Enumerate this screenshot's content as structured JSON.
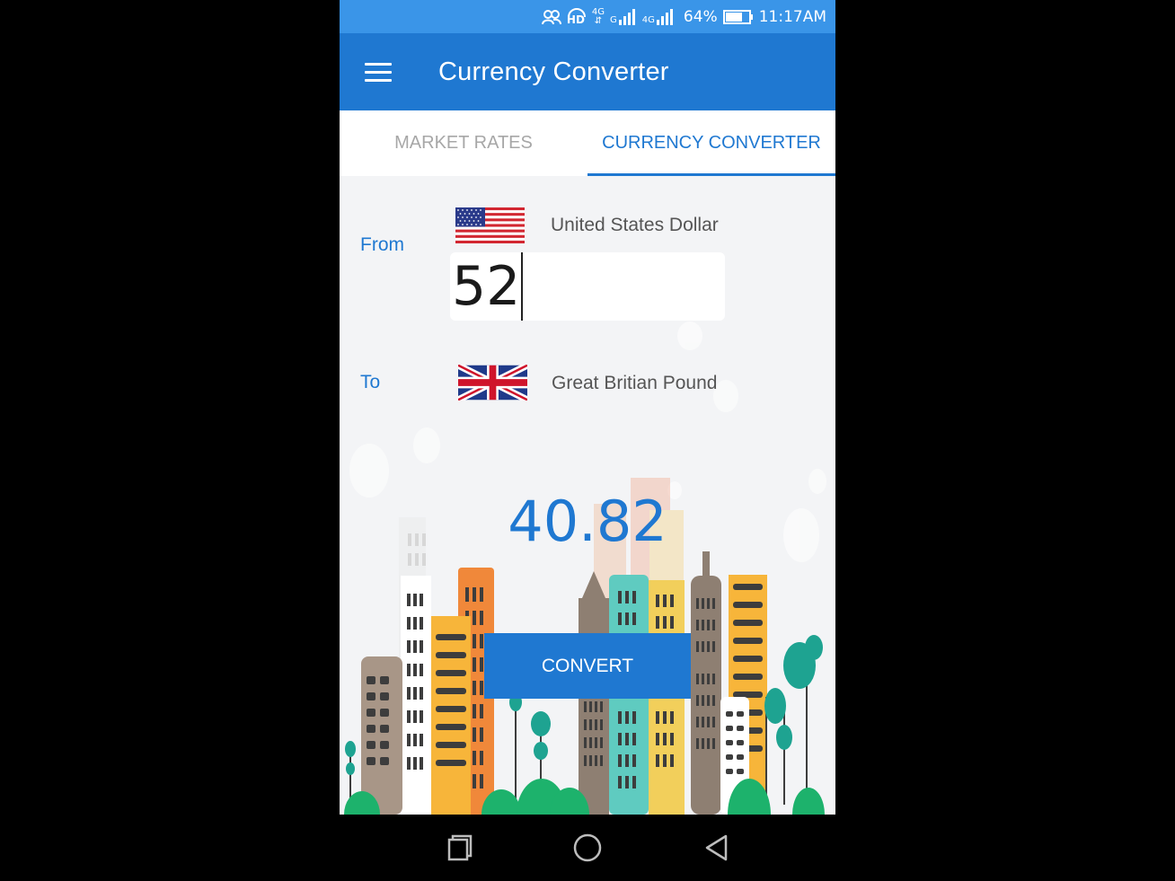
{
  "status_bar": {
    "battery": "64%",
    "time": "11:17AM",
    "net1": "4G",
    "net2": "G",
    "net3": "4G",
    "hd": "HD"
  },
  "app_bar": {
    "title": "Currency Converter",
    "menu_icon": "hamburger-menu-icon"
  },
  "tabs": [
    {
      "label": "MARKET RATES",
      "selected": false
    },
    {
      "label": "CURRENCY CONVERTER",
      "selected": true
    }
  ],
  "converter": {
    "from_label": "From",
    "from_currency": "United States Dollar",
    "from_flag": "us-flag-icon",
    "amount": "52",
    "to_label": "To",
    "to_currency": "Great Britian Pound",
    "to_flag": "uk-flag-icon",
    "result": "40.82",
    "convert_label": "CONVERT"
  },
  "colors": {
    "primary": "#1f78d1",
    "status_bar": "#3a95e8",
    "background": "#f3f4f6"
  },
  "nav_bar": {
    "recent_icon": "recent-apps-icon",
    "home_icon": "home-icon",
    "back_icon": "back-icon"
  }
}
